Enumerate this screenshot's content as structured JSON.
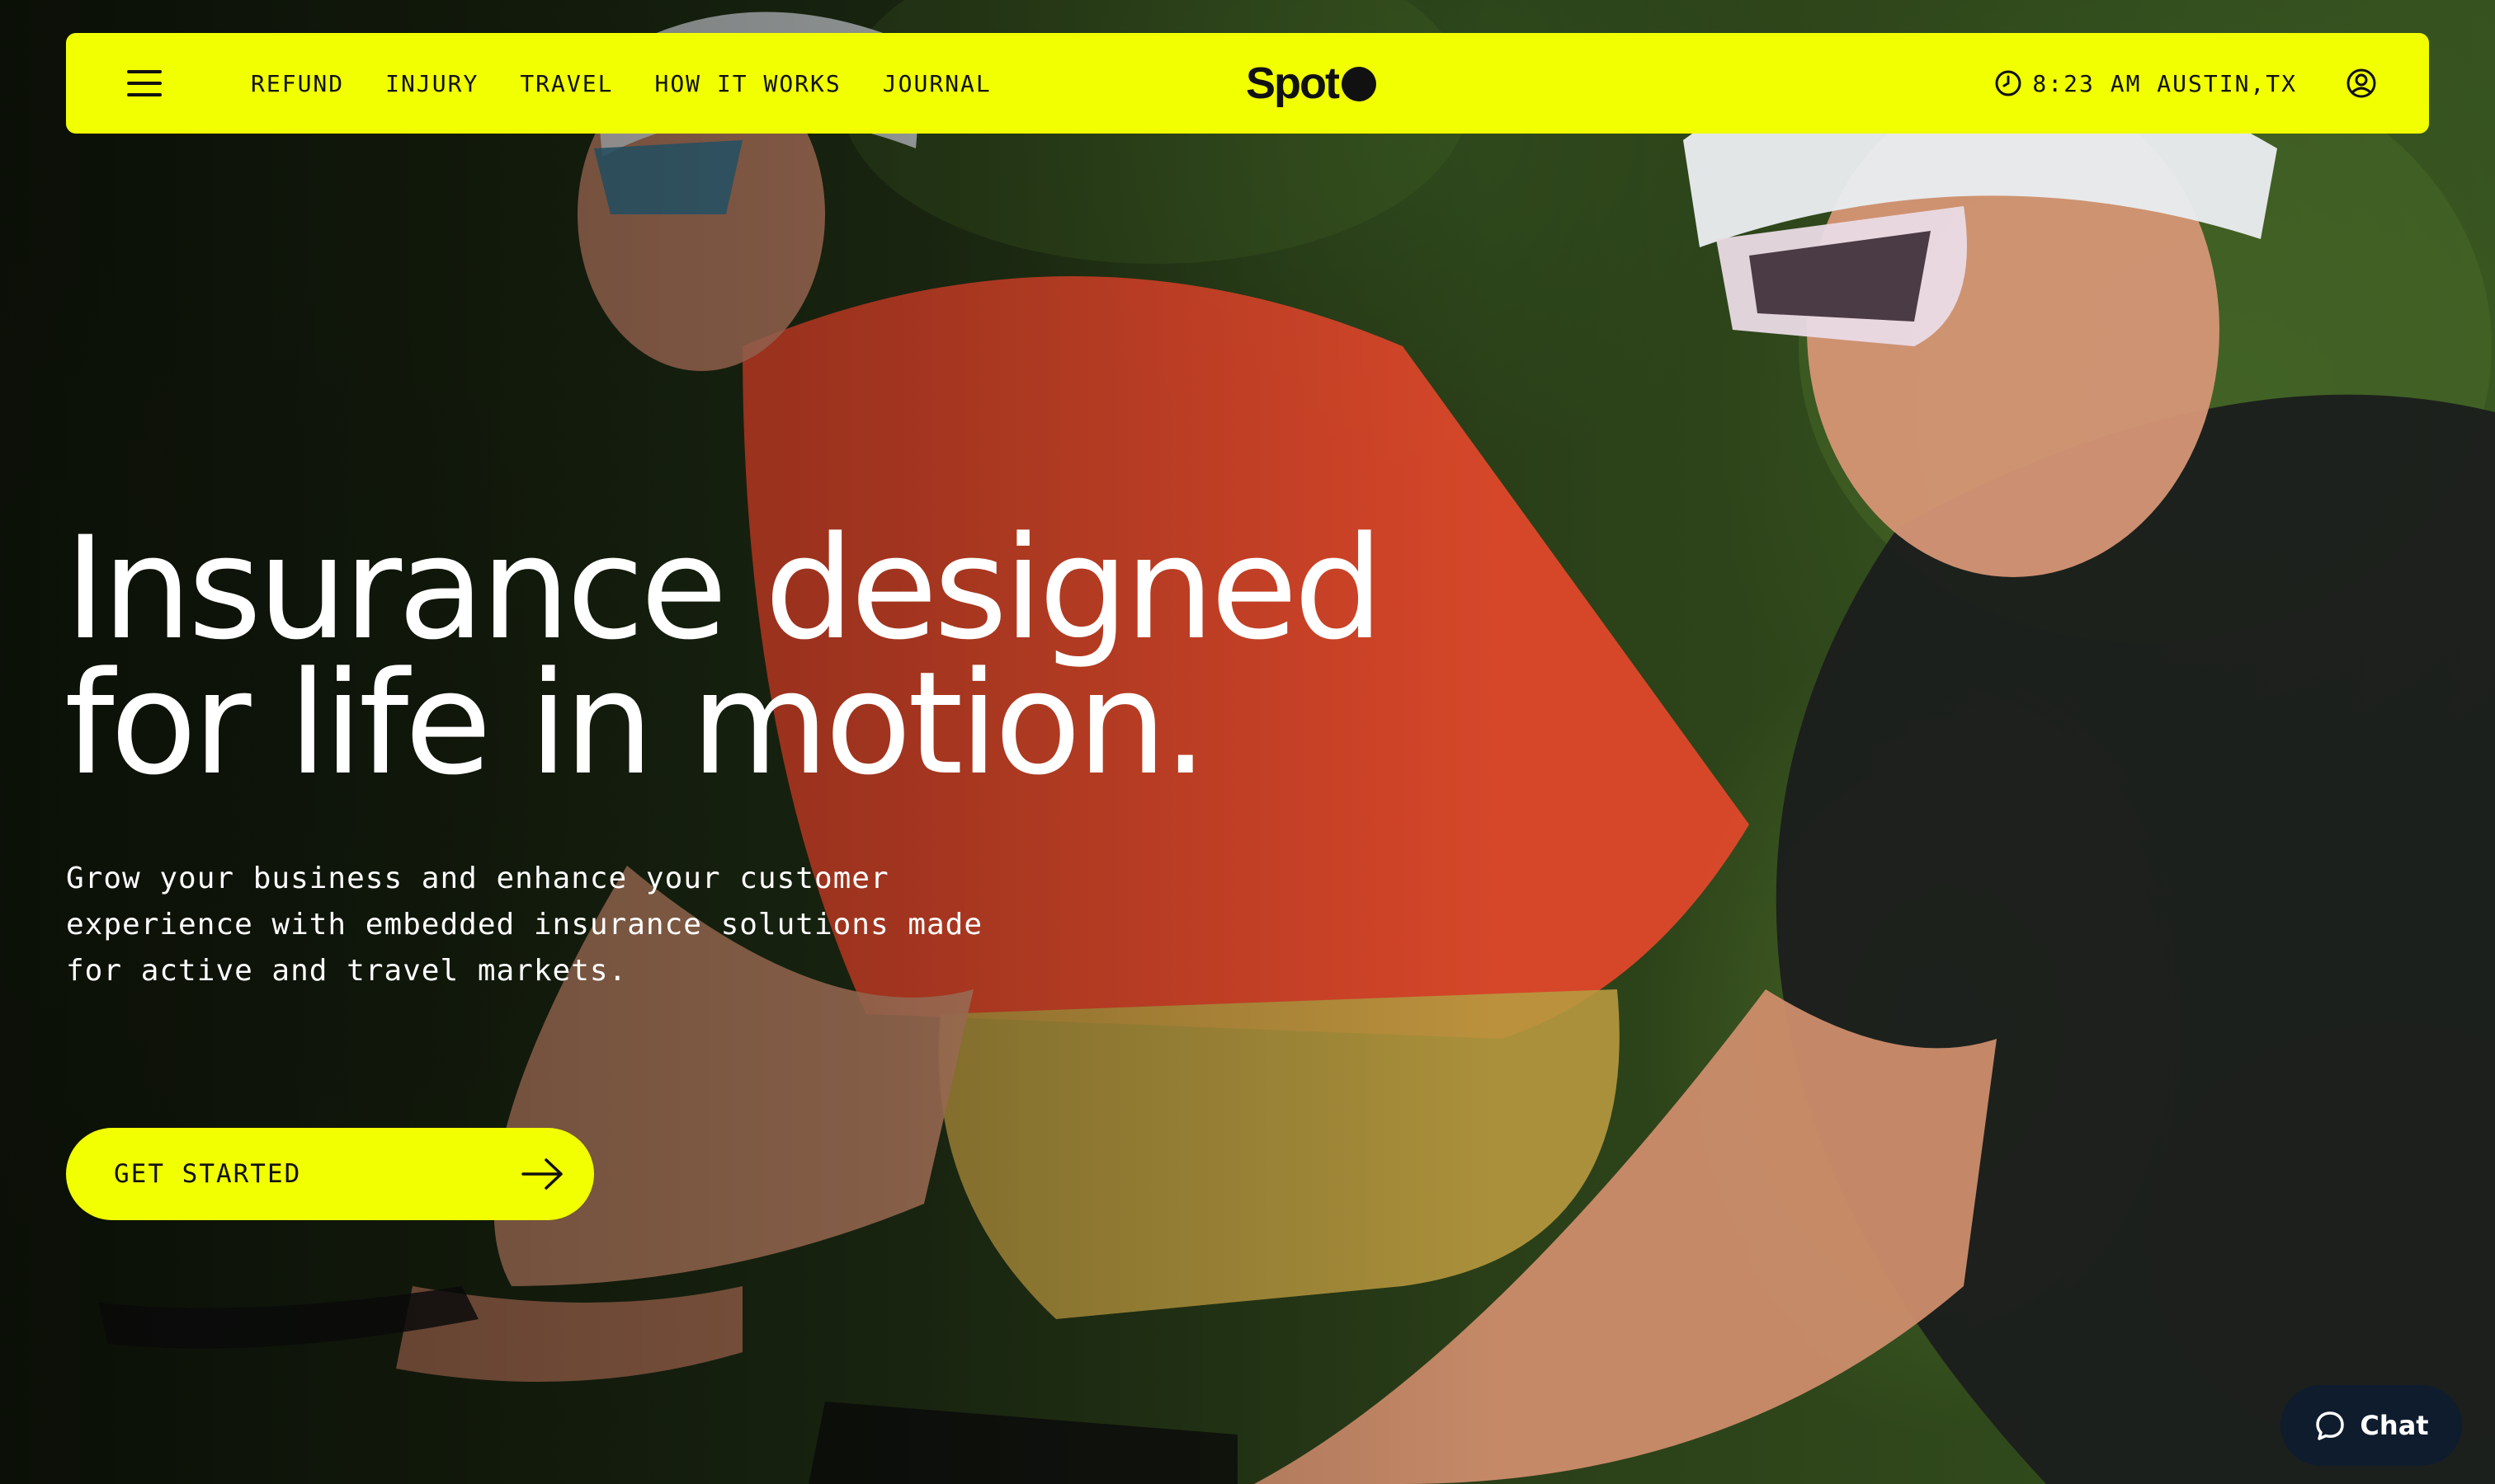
{
  "nav": {
    "menu_icon": "hamburger-menu-icon",
    "links": [
      "REFUND",
      "INJURY",
      "TRAVEL",
      "HOW IT WORKS",
      "JOURNAL"
    ],
    "logo_text": "Spot",
    "clock_icon": "clock-icon",
    "clock_text": "8:23 AM AUSTIN,TX",
    "account_icon": "user-account-icon"
  },
  "hero": {
    "headline_line1": "Insurance designed",
    "headline_line2": "for life in motion.",
    "subcopy": "Grow your business and enhance your customer experience with embedded insurance solutions made for active and travel markets.",
    "cta_label": "GET STARTED",
    "cta_icon": "arrow-right-icon"
  },
  "chat": {
    "label": "Chat",
    "icon": "chat-bubble-icon"
  },
  "colors": {
    "accent": "#f1ff00",
    "text_dark": "#111111",
    "chat_bg": "#0f1c2d"
  }
}
